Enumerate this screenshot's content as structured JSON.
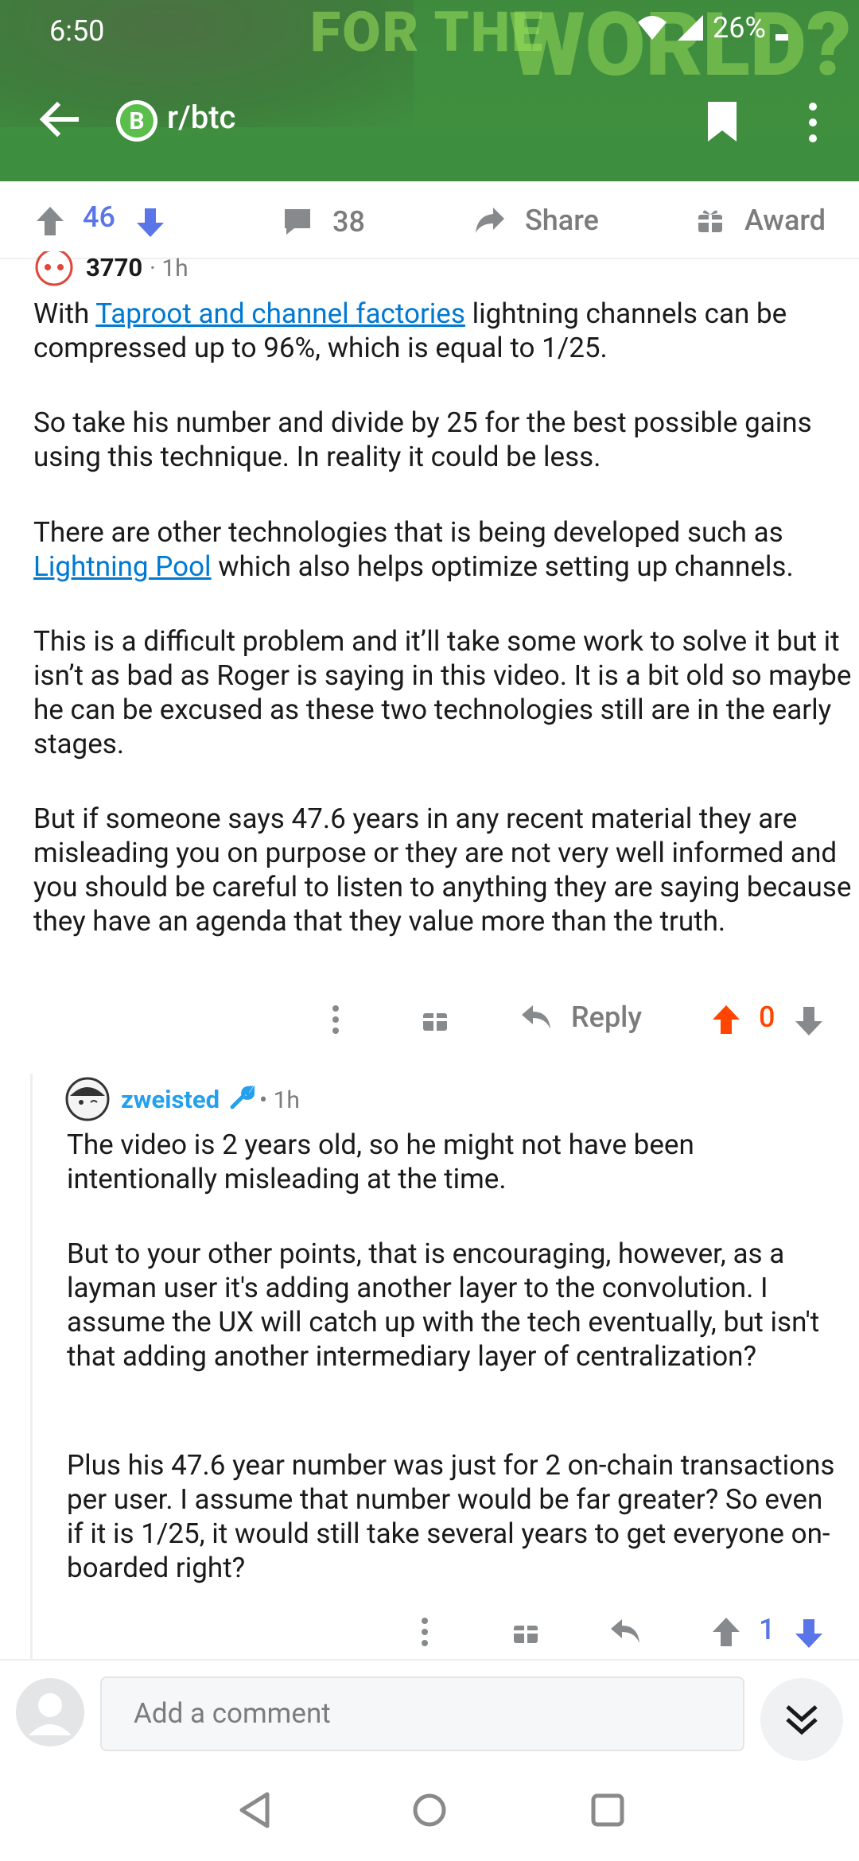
{
  "status_bar": {
    "time": "6:50",
    "battery": "26%"
  },
  "header": {
    "banner_line1": "FOR THE",
    "banner_line2": "WORLD?",
    "subreddit_icon_letter": "B",
    "subreddit": "r/btc"
  },
  "action_bar": {
    "vote_count": "46",
    "comment_count": "38",
    "share_label": "Share",
    "award_label": "Award"
  },
  "comment1": {
    "author": "3770",
    "time": "· 1h",
    "p1_link": "Taproot and channel factories",
    "p1_prefix": "With ",
    "p1_rest": " lightning channels can be compressed up to 96%, which is equal to 1/25.",
    "p2": "So take his number and divide by 25 for the best possible gains using this technique. In reality it could be less.",
    "p3_prefix": "There are other technologies that is being developed such as ",
    "p3_link": "Lightning Pool",
    "p3_rest": " which also helps optimize setting up channels.",
    "p4": "This is a difficult problem and it’ll take some work to solve it but it isn’t as bad as Roger is saying in this video. It is a bit old so maybe he can be excused as these two technologies still are in the early stages.",
    "p5": "But if someone says 47.6 years in any recent material they are misleading you on purpose or they are not very well informed and you should be careful to listen to anything they are saying because they have an agenda that they value more than the truth.",
    "reply_label": "Reply",
    "score": "0"
  },
  "comment2": {
    "author": "zweisted",
    "time": "• 1h",
    "p1": "The video is 2 years old, so he might not have been intentionally misleading at the time.",
    "p2": "But to your other points, that is encouraging, however, as a layman user it's adding another layer to the convolution. I assume the UX will catch up with the tech eventually, but isn't that adding another intermediary layer of centralization?",
    "p3": "Plus his 47.6 year number was just for 2 on-chain transactions per user. I assume that number would be far greater? So even if it is 1/25, it would still take several years to get everyone on-boarded right?",
    "score": "1"
  },
  "comment_input": {
    "placeholder": "Add a comment"
  },
  "colors": {
    "header_green": "#3f8b3e",
    "upvote_orange": "#ff4500",
    "vote_blue": "#5a75e8",
    "link_blue": "#0079d3",
    "mod_blue": "#24a0ed"
  }
}
